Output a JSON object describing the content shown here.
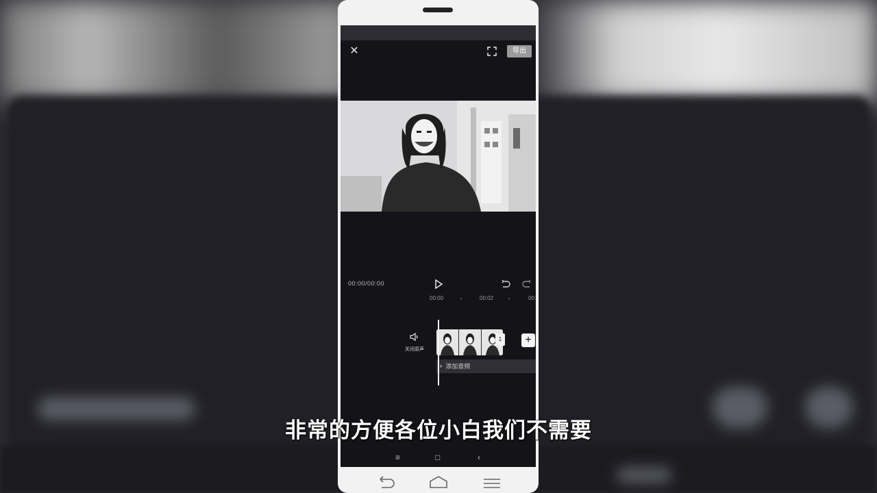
{
  "header": {
    "close_icon": "close-icon",
    "fullscreen_icon": "fullscreen-icon",
    "export_label": "导出"
  },
  "player": {
    "timecode": "00:00/00:00",
    "play_icon": "play-icon",
    "undo_icon": "undo-icon",
    "redo_icon": "redo-icon"
  },
  "ruler": {
    "ticks": [
      "00:00",
      "00:02",
      "00:"
    ]
  },
  "timeline": {
    "mute_label": "关闭原声",
    "clip_duration": "1",
    "add_clip_label": "+",
    "audio_track_plus": "+",
    "audio_track_label": "添加音频"
  },
  "subtitle": {
    "text": "非常的方便各位小白我们不需要"
  },
  "nav": {
    "menu_icon": "≡",
    "home_icon": "□",
    "back_icon": "‹"
  },
  "colors": {
    "screen_bg": "#141418",
    "phone_body": "#f2f2f2",
    "caption": "#ffffff"
  }
}
